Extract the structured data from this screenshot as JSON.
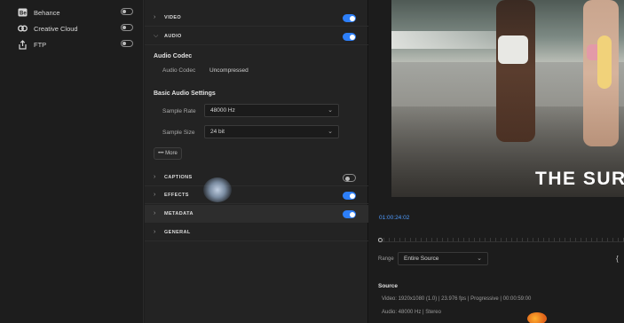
{
  "destinations": [
    {
      "label": "Behance",
      "icon": "behance-icon",
      "enabled": false
    },
    {
      "label": "Creative Cloud",
      "icon": "creative-cloud-icon",
      "enabled": false
    },
    {
      "label": "FTP",
      "icon": "ftp-upload-icon",
      "enabled": false
    }
  ],
  "sections": {
    "video": {
      "title": "VIDEO",
      "enabled": true
    },
    "audio": {
      "title": "AUDIO",
      "enabled": true
    },
    "captions": {
      "title": "CAPTIONS",
      "enabled": false
    },
    "effects": {
      "title": "EFFECTS",
      "enabled": true
    },
    "metadata": {
      "title": "METADATA",
      "enabled": true
    },
    "general": {
      "title": "GENERAL"
    }
  },
  "audio": {
    "codec_heading": "Audio Codec",
    "codec_label": "Audio Codec",
    "codec_value": "Uncompressed",
    "basic_heading": "Basic Audio Settings",
    "sample_rate_label": "Sample Rate",
    "sample_rate_value": "48000 Hz",
    "sample_size_label": "Sample Size",
    "sample_size_value": "24 bit",
    "more_button": "••• More"
  },
  "preview": {
    "overlay_title": "THE SURF",
    "timecode": "01:00:24:02",
    "range_label": "Range",
    "range_value": "Entire Source",
    "bracket_glyph": "{"
  },
  "source": {
    "heading": "Source",
    "video_line": "Video:  1920x1080 (1.0)  |  23.976 fps  |  Progressive  |  00:00:59:00",
    "audio_line": "Audio:  48000 Hz  |  Stereo"
  },
  "colors": {
    "accent": "#2d7ff9",
    "timecode": "#4f9cff"
  }
}
